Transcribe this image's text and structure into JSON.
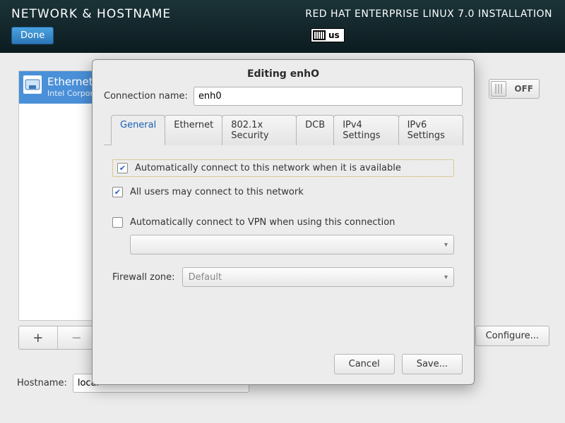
{
  "header": {
    "title_left": "NETWORK & HOSTNAME",
    "title_right": "RED HAT ENTERPRISE LINUX 7.0 INSTALLATION",
    "done_label": "Done",
    "keyboard_layout": "us"
  },
  "device_list": {
    "items": [
      {
        "title": "Ethernet",
        "subtitle": "Intel Corporation"
      }
    ],
    "add_label": "+",
    "remove_label": "−"
  },
  "toggle": {
    "state": "OFF"
  },
  "configure_label": "Configure...",
  "hostname": {
    "label": "Hostname:",
    "value": "local"
  },
  "dialog": {
    "title": "Editing enhO",
    "connection_name_label": "Connection name:",
    "connection_name_value": "enh0",
    "tabs": [
      "General",
      "Ethernet",
      "802.1x Security",
      "DCB",
      "IPv4 Settings",
      "IPv6 Settings"
    ],
    "active_tab": 0,
    "general": {
      "auto_connect_label": "Automatically connect to this network when it is available",
      "auto_connect_checked": true,
      "all_users_label": "All users may connect to this network",
      "all_users_checked": true,
      "auto_vpn_label": "Automatically connect to VPN when using this connection",
      "auto_vpn_checked": false,
      "vpn_selected": "",
      "firewall_zone_label": "Firewall zone:",
      "firewall_zone_value": "Default"
    },
    "buttons": {
      "cancel": "Cancel",
      "save": "Save..."
    }
  }
}
